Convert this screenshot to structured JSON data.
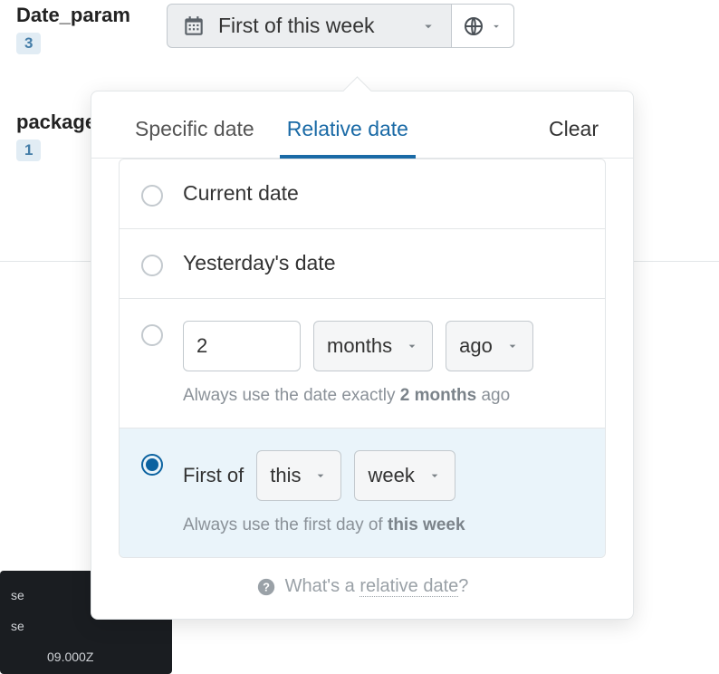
{
  "params": [
    {
      "label": "Date_param",
      "badge": "3"
    },
    {
      "label": "package",
      "badge": "1"
    }
  ],
  "date_button": {
    "text": "First of this week"
  },
  "tabs": {
    "specific": "Specific date",
    "relative": "Relative date",
    "clear": "Clear"
  },
  "options": {
    "current": "Current date",
    "yesterday": "Yesterday's date",
    "relative_n": {
      "value": "2",
      "unit": "months",
      "direction": "ago",
      "hint_prefix": "Always use the date exactly ",
      "hint_strong": "2 months",
      "hint_suffix": " ago"
    },
    "first_of": {
      "prefix": "First of",
      "scope": "this",
      "unit": "week",
      "hint_prefix": "Always use the first day of ",
      "hint_strong": "this week"
    }
  },
  "footer": {
    "prefix": "What's a ",
    "link": "relative date",
    "suffix": "?"
  },
  "dark_rows": [
    "se",
    "se",
    "09.000Z"
  ]
}
